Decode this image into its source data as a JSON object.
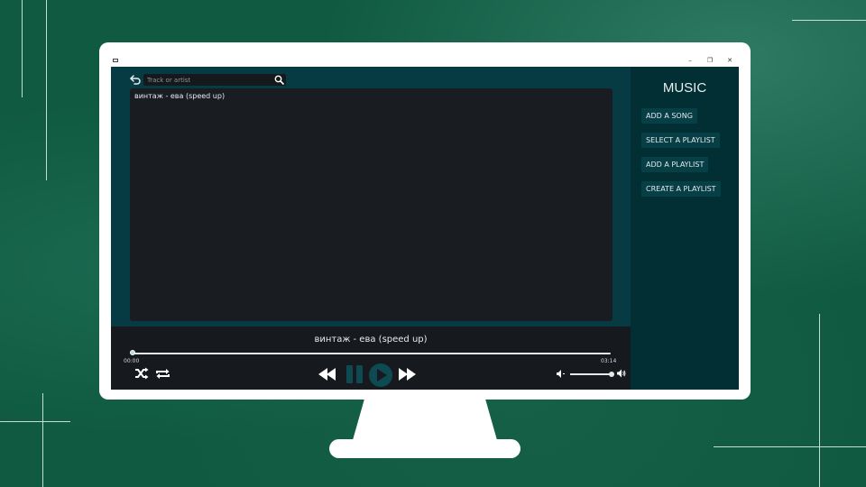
{
  "window": {
    "controls": {
      "minimize": "–",
      "maximize": "❐",
      "close": "✕"
    }
  },
  "search": {
    "placeholder": "Track or artist"
  },
  "playlist": {
    "items": [
      "винтаж - ева (speed up)"
    ]
  },
  "player": {
    "now_playing": "винтаж - ева (speed up)",
    "current_time": "00:00",
    "duration": "03:14",
    "progress": 0.0,
    "volume": 0.95
  },
  "sidebar": {
    "title": "MUSIC",
    "buttons": [
      "ADD A SONG",
      "SELECT A PLAYLIST",
      "ADD A PLAYLIST",
      "CREATE A PLAYLIST"
    ]
  },
  "icons": {
    "back": "back-arrow-icon",
    "search": "magnifier-icon",
    "shuffle": "shuffle-icon",
    "repeat": "repeat-icon",
    "previous": "rewind-icon",
    "pause": "pause-icon",
    "play": "play-icon",
    "next": "fast-forward-icon",
    "volume_down": "volume-low-icon",
    "volume_up": "volume-high-icon"
  },
  "colors": {
    "background": "#0f5a41",
    "pane_dark": "#063b44",
    "sidebar": "#022f34",
    "list_bg": "#191c21",
    "player_bg": "#16191d",
    "button_bg": "#073f47",
    "disabled_icon": "#0d4a52"
  }
}
